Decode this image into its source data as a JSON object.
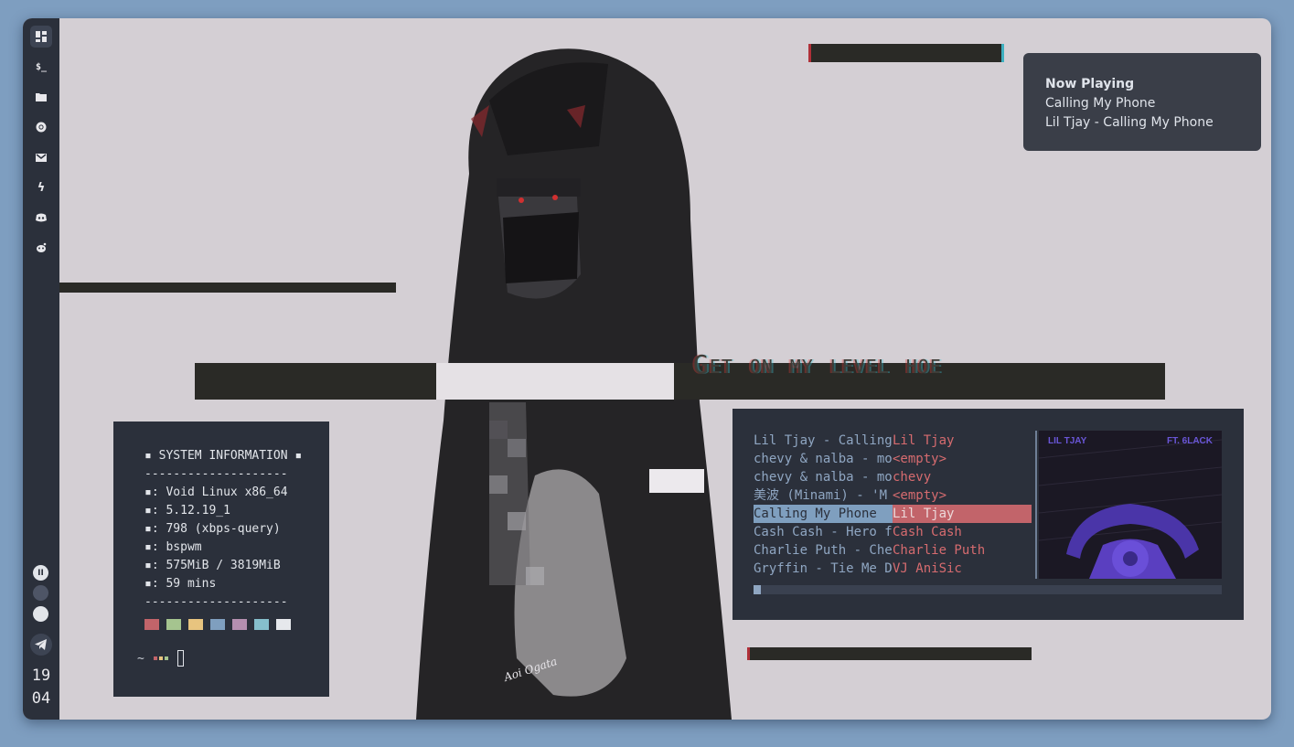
{
  "sidebar": {
    "icons": [
      {
        "name": "dashboard-icon",
        "glyph": "▦"
      },
      {
        "name": "terminal-icon",
        "glyph": "$_"
      },
      {
        "name": "folder-icon",
        "glyph": "■"
      },
      {
        "name": "chrome-icon",
        "glyph": "◉"
      },
      {
        "name": "mail-icon",
        "glyph": "✉"
      },
      {
        "name": "lightning-icon",
        "glyph": "ϟ"
      },
      {
        "name": "discord-icon",
        "glyph": "◓"
      },
      {
        "name": "reddit-icon",
        "glyph": "☻"
      }
    ],
    "workspace_label": "II",
    "clock_hour": "19",
    "clock_minute": "04"
  },
  "wallpaper": {
    "text": "Get on my level hoe",
    "signature": "Aoi Ogata"
  },
  "notification": {
    "title": "Now Playing",
    "line1": "Calling My Phone",
    "line2": "Lil Tjay - Calling My Phone"
  },
  "sysinfo": {
    "header": "▪ SYSTEM INFORMATION ▪",
    "divider": "--------------------",
    "lines": [
      "▪: Void Linux x86_64",
      "▪: 5.12.19_1",
      "▪: 798 (xbps-query)",
      "▪: bspwm",
      "▪: 575MiB / 3819MiB",
      "▪: 59 mins"
    ],
    "colors": [
      "#c2646a",
      "#a5c48f",
      "#e8c47f",
      "#7f9fbf",
      "#b58fb0",
      "#86bfcc",
      "#e6e8ec"
    ],
    "prompt": "~"
  },
  "player": {
    "tracks": [
      {
        "title": "Lil Tjay - Calling",
        "artist": "Lil Tjay"
      },
      {
        "title": "chevy & nalba - mo",
        "artist": "<empty>"
      },
      {
        "title": "chevy & nalba - mo",
        "artist": "chevy"
      },
      {
        "title": "美波 (Minami) - 'M",
        "artist": "<empty>"
      },
      {
        "title": "  Calling My Phone",
        "artist": "Lil Tjay"
      },
      {
        "title": "Cash Cash - Hero f",
        "artist": "Cash Cash"
      },
      {
        "title": "Charlie Puth - Che",
        "artist": "Charlie Puth"
      },
      {
        "title": "Gryffin - Tie Me D",
        "artist": "VJ AniSic"
      }
    ],
    "selected_index": 4,
    "album_artist": "LIL TJAY",
    "album_feature": "FT. 6LACK",
    "progress_fraction": 0.015
  }
}
